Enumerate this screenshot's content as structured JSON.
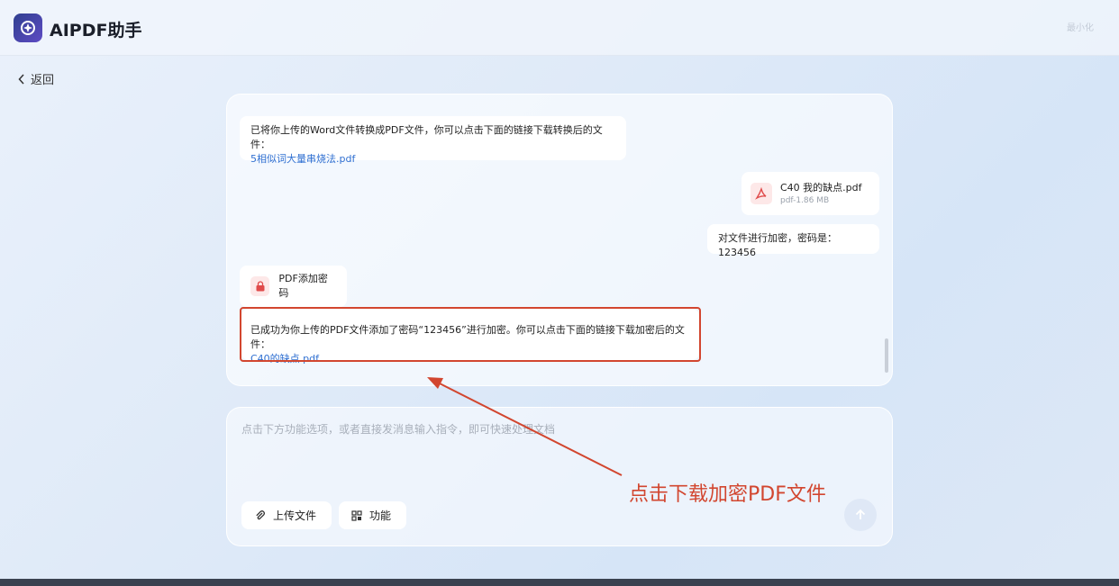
{
  "app": {
    "title": "AIPDF助手",
    "window_ghost": "最小化"
  },
  "nav": {
    "back_label": "返回"
  },
  "chat": {
    "msg1": {
      "text": "已将你上传的Word文件转换成PDF文件，你可以点击下面的链接下载转换后的文件：",
      "link": "5相似词大量串烧法.pdf"
    },
    "file_card": {
      "name": "C40 我的缺点.pdf",
      "meta": "pdf-1.86 MB"
    },
    "user_msg": "对文件进行加密，密码是：123456",
    "tool_card": {
      "label": "PDF添加密码"
    },
    "msg2": {
      "text": "已成功为你上传的PDF文件添加了密码“123456”进行加密。你可以点击下面的链接下载加密后的文件：",
      "link": "C40的缺点.pdf"
    }
  },
  "composer": {
    "placeholder": "点击下方功能选项，或者直接发消息输入指令，即可快速处理文档",
    "upload_label": "上传文件",
    "function_label": "功能"
  },
  "annotation": {
    "text": "点击下载加密PDF文件"
  },
  "colors": {
    "accent": "#2f6fd1",
    "annotation": "#d2462f",
    "pdf_red": "#e04a4a"
  }
}
